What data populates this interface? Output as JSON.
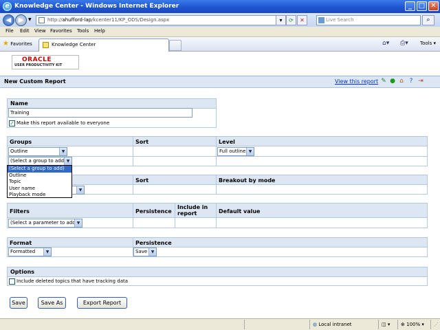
{
  "window": {
    "title": "Knowledge Center - Windows Internet Explorer",
    "minimize_label": "_",
    "maximize_label": "□",
    "close_label": "✕"
  },
  "address": {
    "url_prefix": "http://",
    "url_host": "ahufford-lap",
    "url_path": "/kcenter11/KP_ODS/Design.aspx",
    "search_placeholder": "Live Search"
  },
  "menu": [
    "File",
    "Edit",
    "View",
    "Favorites",
    "Tools",
    "Help"
  ],
  "favorites": {
    "label": "Favorites",
    "tab_title": "Knowledge Center",
    "tools_label": "Tools"
  },
  "logo": {
    "brand": "ORACLE",
    "product": "USER PRODUCTIVITY KIT"
  },
  "header": {
    "title": "New Custom Report",
    "view_link": "View this report"
  },
  "name_section": {
    "heading": "Name",
    "value": "Training",
    "available_label": "Make this report available to everyone",
    "available_checked": true
  },
  "groups_section": {
    "col_groups": "Groups",
    "col_sort": "Sort",
    "col_level": "Level",
    "group_selected": "Outline",
    "level_selected": "Full outline",
    "add_group": "(Select a group to add)",
    "dropdown_options": [
      "(Select a group to add)",
      "Outline",
      "Topic",
      "User name",
      "Playback mode"
    ],
    "highlighted_index": 0
  },
  "breakout_section": {
    "col_sort": "Sort",
    "col_breakout": "Breakout by mode"
  },
  "filters_section": {
    "col_filters": "Filters",
    "col_persistence": "Persistence",
    "col_include": "Include in report",
    "col_default": "Default value",
    "add_param": "(Select a parameter to add)"
  },
  "format_section": {
    "col_format": "Format",
    "col_persistence": "Persistence",
    "format_selected": "Formatted",
    "persistence_selected": "Save"
  },
  "options_section": {
    "heading": "Options",
    "deleted_label": "Include deleted topics that have tracking data",
    "deleted_checked": false
  },
  "buttons": {
    "save": "Save",
    "save_as": "Save As",
    "export": "Export Report"
  },
  "status": {
    "zone": "Local intranet",
    "zoom": "100%"
  },
  "colors": {
    "panel_header": "#dce7f3",
    "panel_border": "#b3c8e0",
    "link": "#0033cc",
    "highlight": "#316ac5"
  }
}
